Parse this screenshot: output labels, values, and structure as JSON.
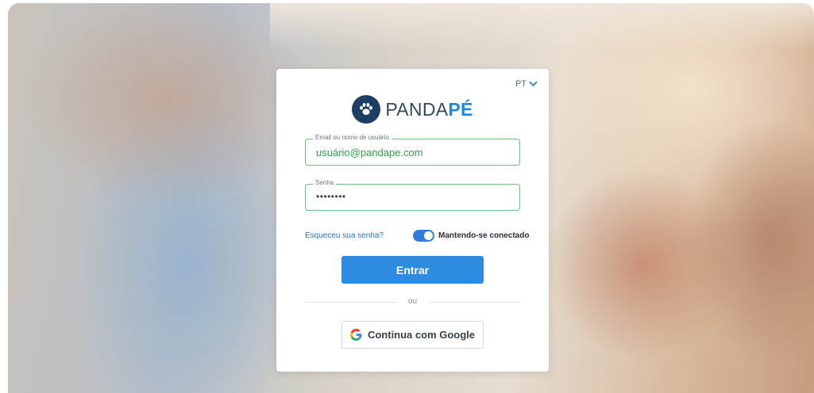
{
  "language": {
    "label": "PT"
  },
  "brand": {
    "name_part1": "PANDA",
    "name_part2": "PÉ"
  },
  "form": {
    "username": {
      "label": "Email ou nome de usuário",
      "value": "usuário@pandape.com"
    },
    "password": {
      "label": "Senha",
      "value": "••••••••"
    },
    "forgot_link": "Esqueceu sua senha?",
    "stay_connected": {
      "label": "Mantendo-se conectado",
      "enabled": true
    },
    "submit_label": "Entrar",
    "divider_text": "ou",
    "google_label": "Continua com Google"
  },
  "colors": {
    "primary": "#2f8be0",
    "brand_dark": "#1d3f66",
    "brand_accent": "#1e88d9",
    "field_border": "#6cc47a",
    "field_text": "#2e9e47"
  },
  "icons": {
    "language_chevron": "chevron-down-icon",
    "brand_logo": "paw-icon",
    "google": "google-icon"
  }
}
